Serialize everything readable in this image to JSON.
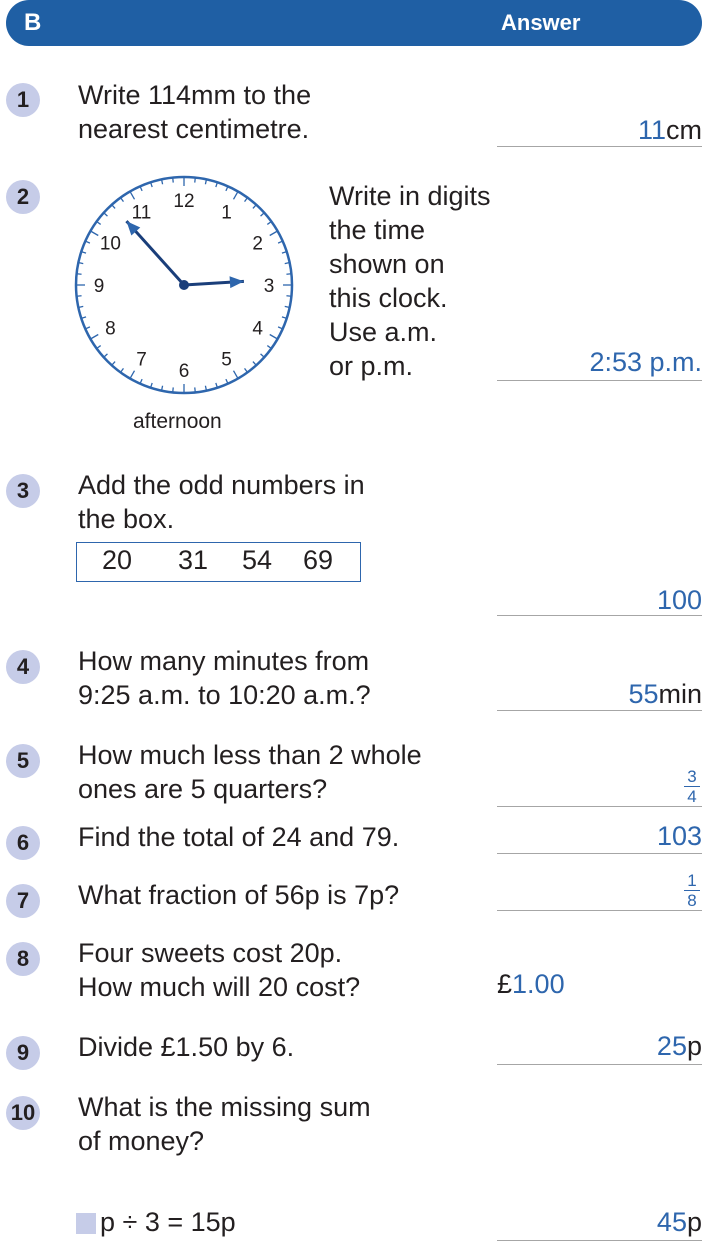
{
  "header": {
    "section": "B",
    "answer_label": "Answer"
  },
  "questions": [
    {
      "num": "1",
      "text": "Write 114mm to the\nnearest centimetre.",
      "answer": "11",
      "unit": "cm"
    },
    {
      "num": "2",
      "text": "Write in digits\nthe time\nshown on\nthis clock.\nUse a.m.\nor p.m.",
      "answer": "2:53 p.m.",
      "caption": "afternoon",
      "clock": {
        "numbers": [
          "12",
          "1",
          "2",
          "3",
          "4",
          "5",
          "6",
          "7",
          "8",
          "9",
          "10",
          "11"
        ],
        "hour": 2,
        "minute": 53
      }
    },
    {
      "num": "3",
      "text": "Add the odd numbers in\nthe box.",
      "box_numbers": [
        "20",
        "31",
        "54",
        "69"
      ],
      "answer": "100"
    },
    {
      "num": "4",
      "text": "How many minutes from\n9:25 a.m. to 10:20 a.m.?",
      "answer": "55",
      "unit": "min"
    },
    {
      "num": "5",
      "text": "How much less than 2 whole\nones are 5 quarters?",
      "answer_num": "3",
      "answer_den": "4"
    },
    {
      "num": "6",
      "text": "Find the total of 24 and 79.",
      "answer": "103"
    },
    {
      "num": "7",
      "text": "What fraction of 56p is 7p?",
      "answer_num": "1",
      "answer_den": "8"
    },
    {
      "num": "8",
      "text": "Four sweets cost 20p.\nHow much will 20 cost?",
      "currency": "£",
      "answer": "1.00"
    },
    {
      "num": "9",
      "text": "Divide £1.50 by 6.",
      "answer": "25",
      "unit": "p"
    },
    {
      "num": "10",
      "text": "What is the missing sum\nof money?",
      "equation": "p ÷ 3 = 15p",
      "answer": "45",
      "unit": "p"
    }
  ],
  "colors": {
    "header": "#1f5fa4",
    "answer_blue": "#2e66ad",
    "badge": "#c6cce8"
  }
}
